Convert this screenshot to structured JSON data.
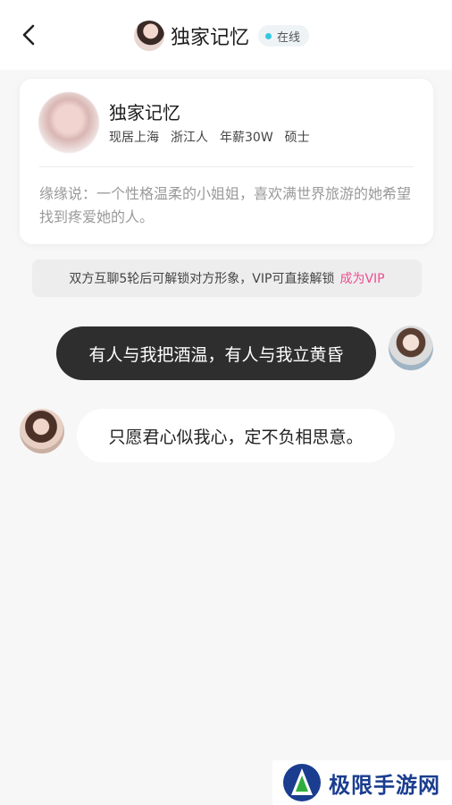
{
  "header": {
    "title": "独家记忆",
    "status_text": "在线",
    "status_color": "#35c9dc",
    "back_icon": "chevron-left-icon"
  },
  "profile_card": {
    "name": "独家记忆",
    "tags": [
      "现居上海",
      "浙江人",
      "年薪30W",
      "硕士"
    ],
    "bio": "缘缘说：一个性格温柔的小姐姐，喜欢满世界旅游的她希望找到疼爱她的人。"
  },
  "notice": {
    "text": "双方互聊5轮后可解锁对方形象，VIP可直接解锁",
    "link_text": "成为VIP",
    "link_color": "#ee4d8d"
  },
  "messages": [
    {
      "from": "me",
      "text": "有人与我把酒温，有人与我立黄昏"
    },
    {
      "from": "them",
      "text": "只愿君心似我心，定不负相思意。"
    }
  ],
  "watermark": {
    "text": "极限手游网"
  }
}
